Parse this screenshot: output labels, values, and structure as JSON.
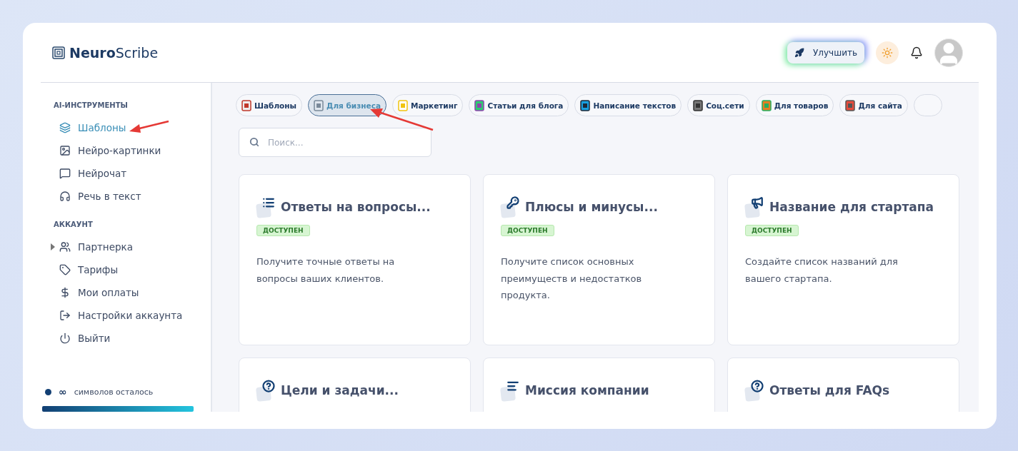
{
  "brand": "**Neuro**Scribe",
  "header": {
    "upgrade_button": "Улучшить"
  },
  "sidebar": {
    "sections": [
      {
        "title": "AI-ИНСТРУМЕНТЫ",
        "items": [
          {
            "label": "Шаблоны",
            "selected": true
          },
          {
            "label": "Нейро-картинки",
            "selected": false
          },
          {
            "label": "Нейрочат",
            "selected": false
          },
          {
            "label": "Речь в текст",
            "selected": false
          }
        ]
      },
      {
        "title": "АККАУНТ",
        "items": [
          {
            "label": "Партнерка",
            "selected": false,
            "expanded": false
          },
          {
            "label": "Тарифы",
            "selected": false
          },
          {
            "label": "Мои оплаты",
            "selected": false
          },
          {
            "label": "Настройки аккаунта",
            "selected": false
          },
          {
            "label": "Выйти",
            "selected": false
          }
        ]
      }
    ],
    "credits": {
      "amount": "∞",
      "label": "символов осталось",
      "level": 1
    }
  },
  "categories": [
    {
      "label": "Шаблоны",
      "selected": false
    },
    {
      "label": "Для бизнеса",
      "selected": true
    },
    {
      "label": "Маркетинг",
      "selected": false
    },
    {
      "label": "Статьи для блога",
      "selected": false
    },
    {
      "label": "Написание текстов",
      "selected": false
    },
    {
      "label": "Соц.сети",
      "selected": false
    },
    {
      "label": "Для товаров",
      "selected": false
    },
    {
      "label": "Для сайта",
      "selected": false
    }
  ],
  "search": {
    "placeholder": "Поиск..."
  },
  "cards": [
    {
      "title": "Ответы на вопросы...",
      "badge": "ДОСТУПЕН",
      "description": "Получите точные ответы на вопросы ваших клиентов."
    },
    {
      "title": "Плюсы и минусы...",
      "badge": "ДОСТУПЕН",
      "description": "Получите список основных преимуществ и недостатков продукта."
    },
    {
      "title": "Название для стартапа",
      "badge": "ДОСТУПЕН",
      "description": "Создайте список названий для вашего стартапа."
    },
    {
      "title": "Цели и задачи..."
    },
    {
      "title": "Миссия компании"
    },
    {
      "title": "Ответы для FAQs"
    }
  ]
}
